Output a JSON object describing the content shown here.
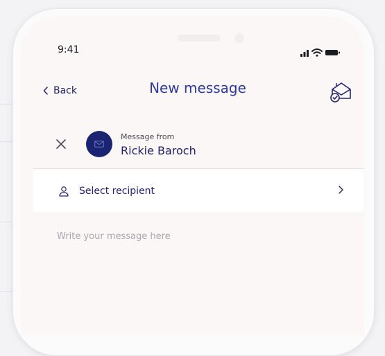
{
  "status_bar": {
    "time": "9:41",
    "icons": [
      "signal-icon",
      "wifi-icon",
      "battery-icon"
    ]
  },
  "nav": {
    "back_label": "Back",
    "title": "New message",
    "compose_icon": "envelope-open-check-icon"
  },
  "sender": {
    "caption": "Message from",
    "name": "Rickie Baroch",
    "avatar_icon": "envelope-icon"
  },
  "recipient": {
    "label": "Select recipient"
  },
  "message": {
    "placeholder": "Write your message here",
    "value": ""
  },
  "colors": {
    "accent": "#2d3a9a",
    "navy": "#1b2470",
    "screen_bg": "#fcf7f7",
    "row_bg": "#ffffff",
    "placeholder": "#a7a6ad"
  }
}
